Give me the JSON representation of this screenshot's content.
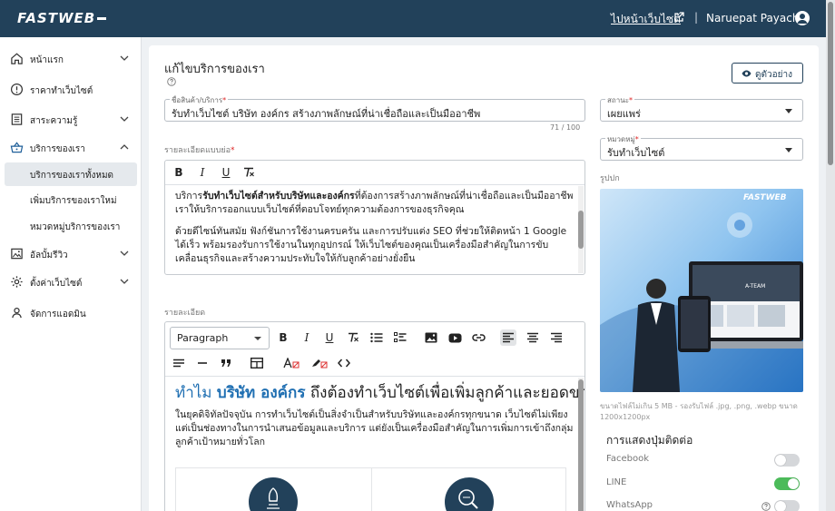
{
  "header": {
    "logo": "FASTWEB",
    "visit_site": "ไปหน้าเว็บไซต์",
    "separator": "|",
    "user_name": "Naruepat Payachai"
  },
  "sidebar": {
    "items": [
      {
        "label": "หน้าแรก",
        "icon": "home-icon",
        "chevron": "down"
      },
      {
        "label": "ราคาทำเว็บไซต์",
        "icon": "info-circle-icon",
        "chevron": ""
      },
      {
        "label": "สาระความรู้",
        "icon": "article-icon",
        "chevron": "down"
      },
      {
        "label": "บริการของเรา",
        "icon": "basket-icon",
        "chevron": "up"
      },
      {
        "label": "อัลบั้มรีวิว",
        "icon": "gallery-icon",
        "chevron": "down"
      },
      {
        "label": "ตั้งค่าเว็บไซต์",
        "icon": "gear-icon",
        "chevron": "down"
      },
      {
        "label": "จัดการแอดมิน",
        "icon": "user-icon",
        "chevron": ""
      }
    ],
    "sub_items": [
      {
        "label": "บริการของเราทั้งหมด",
        "active": true
      },
      {
        "label": "เพิ่มบริการของเราใหม่",
        "active": false
      },
      {
        "label": "หมวดหมู่บริการของเรา",
        "active": false
      }
    ]
  },
  "main": {
    "title": "แก้ไขบริการของเรา",
    "preview_button": "ดูตัวอย่าง",
    "name_field": {
      "label": "ชื่อสินค้า/บริการ",
      "required": "*",
      "value": "รับทำเว็บไซต์ บริษัท องค์กร สร้างภาพลักษณ์ที่น่าเชื่อถือและเป็นมืออาชีพ",
      "counter": "71 / 100"
    },
    "short_desc": {
      "label": "รายละเอียดแบบย่อ",
      "required": "*",
      "p1_pre": "บริการ",
      "p1_bold": "รับทำเว็บไซต์สำหรับบริษัทและองค์กร",
      "p1_post": "ที่ต้องการสร้างภาพลักษณ์ที่น่าเชื่อถือและเป็นมืออาชีพ เราให้บริการออกแบบเว็บไซต์ที่ตอบโจทย์ทุกความต้องการของธุรกิจคุณ",
      "p2": "ด้วยดีไซน์ทันสมัย ฟังก์ชันการใช้งานครบครัน และการปรับแต่ง SEO ที่ช่วยให้ติดหน้า 1 Google ได้เร็ว พร้อมรองรับการใช้งานในทุกอุปกรณ์ ให้เว็บไซต์ของคุณเป็นเครื่องมือสำคัญในการขับเคลื่อนธุรกิจและสร้างความประทับใจให้กับลูกค้าอย่างยั่งยืน"
    },
    "detail": {
      "label": "รายละเอียด",
      "paragraph_select": "Paragraph",
      "heading_pre": "ทำไม ",
      "heading_bold": "บริษัท องค์กร",
      "heading_post": " ถึงต้องทำเว็บไซต์เพื่อเพิ่มลูกค้าและยอดขาย",
      "body": "ในยุคดิจิทัลปัจจุบัน การทำเว็บไซต์เป็นสิ่งจำเป็นสำหรับบริษัทและองค์กรทุกขนาด เว็บไซต์ไม่เพียงแต่เป็นช่องทางในการนำเสนอข้อมูลและบริการ แต่ยังเป็นเครื่องมือสำคัญในการเพิ่มการเข้าถึงกลุ่มลูกค้าเป้าหมายทั่วโลก"
    },
    "status": {
      "label": "สถานะ",
      "required": "*",
      "value": "เผยแพร่"
    },
    "category": {
      "label": "หมวดหมู่",
      "required": "*",
      "value": "รับทำเว็บไซต์"
    },
    "cover": {
      "label": "รูปปก",
      "logo": "FASTWEB",
      "screen_text": "A-TEAM"
    },
    "upload_note": "ขนาดไฟล์ไม่เกิน 5 MB - รองรับไฟล์ .jpg, .png, .webp ขนาด 1200x1200px",
    "contact": {
      "title": "การแสดงปุ่มติดต่อ",
      "items": [
        {
          "label": "Facebook",
          "on": false
        },
        {
          "label": "LINE",
          "on": true
        },
        {
          "label": "WhatsApp",
          "on": false
        }
      ]
    }
  },
  "colors": {
    "header_bg": "#22415a",
    "accent_blue": "#1f6fb2",
    "toggle_on": "#4cbb5a",
    "toggle_off": "#d5d7da"
  }
}
